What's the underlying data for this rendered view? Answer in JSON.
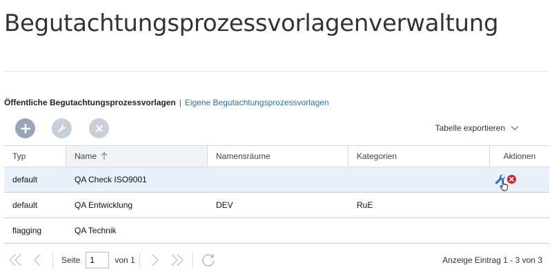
{
  "page": {
    "title": "Begutachtungsprozessvorlagenverwaltung"
  },
  "subtabs": {
    "active": "Öffentliche Begutachtungsprozessvorlagen",
    "separator": "|",
    "link": "Eigene Begutachtungsprozessvorlagen"
  },
  "toolbar": {
    "add_icon": "plus-icon",
    "edit_icon": "wrench-icon",
    "delete_icon": "close-icon",
    "export_label": "Tabelle exportieren"
  },
  "table": {
    "columns": [
      {
        "key": "typ",
        "label": "Typ"
      },
      {
        "key": "name",
        "label": "Name",
        "sorted": "ascending"
      },
      {
        "key": "namespaces",
        "label": "Namensräume"
      },
      {
        "key": "categories",
        "label": "Kategorien"
      },
      {
        "key": "actions",
        "label": "Aktionen"
      }
    ],
    "rows": [
      {
        "typ": "default",
        "name": "QA Check ISO9001",
        "namespaces": "",
        "categories": "",
        "selected": true,
        "actions": [
          "wrench-icon",
          "delete-icon"
        ]
      },
      {
        "typ": "default",
        "name": "QA Entwicklung",
        "namespaces": "DEV",
        "categories": "RuE",
        "selected": false,
        "actions": []
      },
      {
        "typ": "flagging",
        "name": "QA Technik",
        "namespaces": "",
        "categories": "",
        "selected": false,
        "actions": []
      }
    ]
  },
  "pager": {
    "page_label": "Seite",
    "page_value": "1",
    "of_label": "von 1",
    "info": "Anzeige Eintrag 1 - 3 von 3"
  },
  "colors": {
    "accent": "#2a6fa8",
    "button": "#c8cfd8",
    "button_primary": "#97a5b8",
    "selected_row": "#e8f0fa",
    "delete": "#d2222d"
  }
}
